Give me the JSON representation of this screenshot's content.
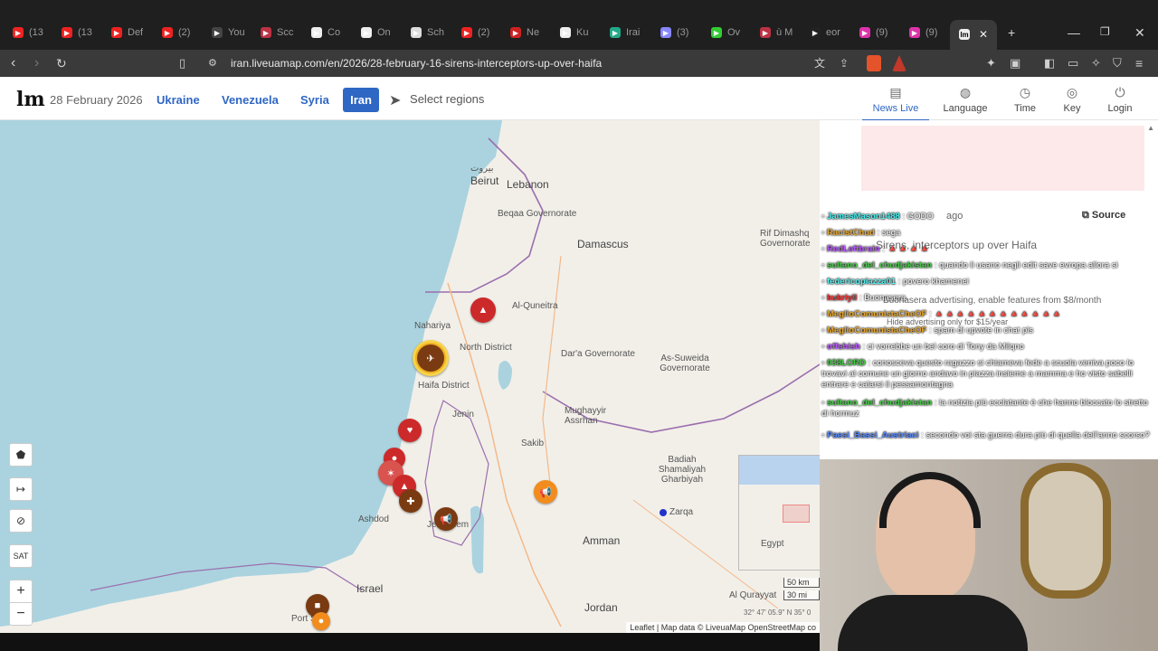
{
  "tabs": [
    {
      "label": "(13",
      "icon": "youtube-icon",
      "color": "#e22"
    },
    {
      "label": "(13",
      "icon": "youtube-icon",
      "color": "#e22"
    },
    {
      "label": "Def",
      "icon": "youtube-icon",
      "color": "#e22"
    },
    {
      "label": "(2)",
      "icon": "youtube-icon",
      "color": "#e22"
    },
    {
      "label": "You",
      "icon": "page-icon",
      "color": "#444"
    },
    {
      "label": "Scc",
      "icon": "shield-icon",
      "color": "#b34"
    },
    {
      "label": "Co",
      "icon": "wikipedia-icon",
      "color": "#eee"
    },
    {
      "label": "On",
      "icon": "wikipedia-icon",
      "color": "#eee"
    },
    {
      "label": "Sch",
      "icon": "openai-icon",
      "color": "#ddd"
    },
    {
      "label": "(2)",
      "icon": "youtube-icon",
      "color": "#e22"
    },
    {
      "label": "Ne",
      "icon": "news-icon",
      "color": "#c22"
    },
    {
      "label": "Ku",
      "icon": "liveuamap-icon",
      "color": "#eee"
    },
    {
      "label": "Irai",
      "icon": "globe-icon",
      "color": "#2a8"
    },
    {
      "label": "(3)",
      "icon": "mail-icon",
      "color": "#88f"
    },
    {
      "label": "Ov",
      "icon": "k-icon",
      "color": "#3c3"
    },
    {
      "label": "ù M",
      "icon": "shield-icon",
      "color": "#b34"
    },
    {
      "label": "eor",
      "icon": "tiktok-icon",
      "color": "#222"
    },
    {
      "label": "(9)",
      "icon": "instagram-icon",
      "color": "#d3a"
    },
    {
      "label": "(9)",
      "icon": "instagram-icon",
      "color": "#d3a"
    }
  ],
  "active_tab_icon": "liveuamap-icon",
  "address": {
    "url": "iran.liveuamap.com/en/2026/28-february-16-sirens-interceptors-up-over-haifa"
  },
  "site": {
    "logo": "lm",
    "date": "28 February 2026",
    "regions": [
      "Ukraine",
      "Venezuela",
      "Syria"
    ],
    "active_region": "Iran",
    "select_regions": "Select regions",
    "nav": [
      {
        "label": "News Live",
        "icon": "news-icon",
        "active": true
      },
      {
        "label": "Language",
        "icon": "globe-icon"
      },
      {
        "label": "Time",
        "icon": "clock-icon"
      },
      {
        "label": "Key",
        "icon": "compass-icon"
      },
      {
        "label": "Login",
        "icon": "login-icon"
      }
    ]
  },
  "map": {
    "cities": [
      {
        "name": "بيروت",
        "big": false
      },
      {
        "name": "Beirut",
        "big": true
      },
      {
        "name": "Lebanon",
        "big": true
      },
      {
        "name": "Damascus",
        "big": true
      },
      {
        "name": "Al-Quneitra",
        "big": false
      },
      {
        "name": "North District",
        "big": false
      },
      {
        "name": "Haifa District",
        "big": false
      },
      {
        "name": "Nahariya",
        "big": false
      },
      {
        "name": "Dar'a Governorate",
        "big": false
      },
      {
        "name": "As-Suweida Governorate",
        "big": false
      },
      {
        "name": "Mughayyir Assrhan",
        "big": false
      },
      {
        "name": "Jenin",
        "big": false
      },
      {
        "name": "Sakib",
        "big": false
      },
      {
        "name": "Badiah Shamaliyah Gharbiyah",
        "big": false
      },
      {
        "name": "Amman",
        "big": true
      },
      {
        "name": "Jordan",
        "big": true
      },
      {
        "name": "Israel",
        "big": true
      },
      {
        "name": "Ashdod",
        "big": false
      },
      {
        "name": "Jerusalem",
        "big": false
      },
      {
        "name": "Zarqa",
        "big": false
      },
      {
        "name": "Port Said",
        "big": false
      },
      {
        "name": "Al Qurayyat",
        "big": false
      },
      {
        "name": "Rif Dimashq Governorate",
        "big": false
      },
      {
        "name": "Beqaa Governorate",
        "big": false
      },
      {
        "name": "Egypt",
        "big": false
      }
    ],
    "controls": {
      "sat": "SAT",
      "zoom_in": "+",
      "zoom_out": "−"
    },
    "scale_km": "50 km",
    "scale_mi": "30 mi",
    "coord": "32° 47' 05.9\" N 35° 0",
    "attribution": "Leaflet | Map data © LiveuaMap OpenStreetMap co",
    "colors": {
      "sea": "#aad3df",
      "land": "#f2efe9",
      "red_marker": "#cc2a2a",
      "orange_marker": "#f28c1c",
      "brown_marker": "#7a3b12"
    }
  },
  "panel": {
    "source_label": "Source",
    "ghost_time": "ago",
    "ghost_headline": "Sirens, interceptors up over Haifa",
    "ghost_ad": "Buonasera advertising, enable features from $8/month",
    "ghost_hide": "Hide advertising only for $15/year"
  },
  "chat": [
    {
      "user": "JamesMason1488",
      "color": "#4ee",
      "text": ": GODO"
    },
    {
      "user": "RacistChud",
      "color": "#e9a830",
      "text": ": sega"
    },
    {
      "user": "RedLeftbrain",
      "color": "#b5f",
      "text": ": 🔺🔺🔺🔺"
    },
    {
      "user": "sultano_del_chudjakistan",
      "color": "#4c4",
      "text": ": quando li usano negli edit save evropa allora si"
    },
    {
      "user": "federicopiazza01",
      "color": "#5ee",
      "text": ": povero khamenei"
    },
    {
      "user": "kukriyil",
      "color": "#e33",
      "text": ": Buonasera"
    },
    {
      "user": "MeglioComunistaCheOF",
      "color": "#e9a830",
      "text": ": 🔺🔺🔺🔺🔺🔺🔺🔺🔺🔺🔺🔺"
    },
    {
      "user": "MeglioComunistaCheOF",
      "color": "#e9a830",
      "text": ": spam di upvote in chat pls"
    },
    {
      "user": "offshish",
      "color": "#b5f",
      "text": ": ci vorrebbe un bel coro di Tony da Milqno"
    },
    {
      "user": "038LORD",
      "color": "#4c4",
      "text": ": conosceva questo ragazzo si chiameva fede a scuola veniva poco lo trovavi al comune un giorno andavo in piazza insieme a mamma e ho visto sabelli entrare e calarsi il pessamontagna"
    },
    {
      "user": "sultano_del_chudjakistan",
      "color": "#4c4",
      "text": ": la notizia più ecclatante è che hanno bloccato lo stretto di hormuz"
    },
    {
      "user": "Paesi_Bassi_Austriaci",
      "color": "#58f",
      "text": ": secondo voi sta guerra dura più di quella dell'anno scorso?"
    }
  ]
}
